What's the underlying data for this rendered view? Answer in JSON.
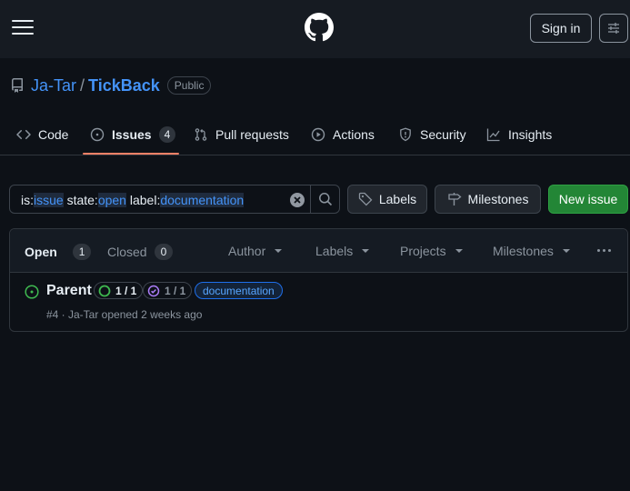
{
  "header": {
    "signin_label": "Sign in"
  },
  "repo": {
    "owner": "Ja-Tar",
    "separator": "/",
    "name": "TickBack",
    "visibility": "Public"
  },
  "tabs": [
    {
      "label": "Code",
      "icon": "code-icon"
    },
    {
      "label": "Issues",
      "icon": "issue-opened-icon",
      "count": "4",
      "active": true
    },
    {
      "label": "Pull requests",
      "icon": "git-pull-request-icon"
    },
    {
      "label": "Actions",
      "icon": "play-icon"
    },
    {
      "label": "Security",
      "icon": "shield-icon"
    },
    {
      "label": "Insights",
      "icon": "graph-icon"
    }
  ],
  "search": {
    "q1_key": "is:",
    "q1_val": "issue",
    "q2_key": " state:",
    "q2_val": "open",
    "q3_key": " label:",
    "q3_val": "documentation"
  },
  "actions": {
    "labels": "Labels",
    "milestones": "Milestones",
    "new_issue": "New issue"
  },
  "list_header": {
    "open_label": "Open",
    "open_count": "1",
    "closed_label": "Closed",
    "closed_count": "0",
    "filters": [
      "Author",
      "Labels",
      "Projects",
      "Milestones"
    ]
  },
  "issues": [
    {
      "title": "Parent",
      "sub_issues_open": "1 / 1",
      "sub_issues_done": "1 / 1",
      "label": "documentation",
      "meta": "#4 · Ja-Tar opened 2 weeks ago"
    }
  ],
  "colors": {
    "accent": "#4493f8",
    "open_green": "#3fb950",
    "primary_button": "#238636",
    "done_purple": "#ab7df8",
    "tab_underline": "#f78166"
  }
}
